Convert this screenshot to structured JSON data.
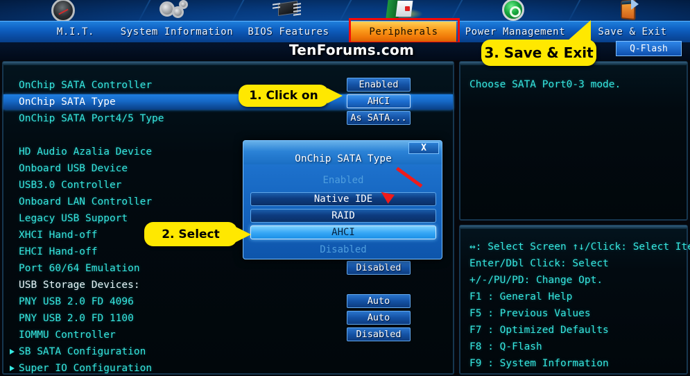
{
  "banner": {
    "icons": [
      {
        "name": "gauge-icon"
      },
      {
        "name": "gears-icon"
      },
      {
        "name": "chip-icon"
      },
      {
        "name": "peripherals-flag-icon"
      },
      {
        "name": "power-icon"
      },
      {
        "name": "exit-door-icon"
      }
    ]
  },
  "tabs": [
    {
      "label": "M.I.T.",
      "active": false
    },
    {
      "label": "System Information",
      "active": false
    },
    {
      "label": "BIOS Features",
      "active": false
    },
    {
      "label": "Peripherals",
      "active": true
    },
    {
      "label": "Power Management",
      "active": false
    },
    {
      "label": "Save & Exit",
      "active": false
    }
  ],
  "watermark": "TenForums.com",
  "qflash_label": "Q-Flash",
  "settings": [
    {
      "label": "OnChip SATA Controller",
      "value": "Enabled",
      "selected": false,
      "submenu": false,
      "white": false
    },
    {
      "label": "OnChip SATA Type",
      "value": "AHCI",
      "selected": true,
      "submenu": false,
      "white": false,
      "value_hot": true
    },
    {
      "label": "OnChip SATA Port4/5 Type",
      "value": "As SATA...",
      "selected": false,
      "submenu": false,
      "white": false
    },
    {
      "label": "HD Audio Azalia Device",
      "value": "",
      "selected": false,
      "submenu": false,
      "white": false
    },
    {
      "label": "Onboard USB Device",
      "value": "",
      "selected": false,
      "submenu": false,
      "white": false
    },
    {
      "label": "USB3.0 Controller",
      "value": "",
      "selected": false,
      "submenu": false,
      "white": false
    },
    {
      "label": "Onboard LAN Controller",
      "value": "",
      "selected": false,
      "submenu": false,
      "white": false
    },
    {
      "label": "Legacy USB Support",
      "value": "",
      "selected": false,
      "submenu": false,
      "white": false
    },
    {
      "label": "XHCI Hand-off",
      "value": "",
      "selected": false,
      "submenu": false,
      "white": false
    },
    {
      "label": "EHCI Hand-off",
      "value": "",
      "selected": false,
      "submenu": false,
      "white": false
    },
    {
      "label": "Port 60/64 Emulation",
      "value": "Disabled",
      "selected": false,
      "submenu": false,
      "white": false
    },
    {
      "label": "USB Storage Devices:",
      "value": "",
      "selected": false,
      "submenu": false,
      "white": true
    },
    {
      "label": "PNY USB 2.0 FD 4096",
      "value": "Auto",
      "selected": false,
      "submenu": false,
      "white": false
    },
    {
      "label": "PNY USB 2.0 FD 1100",
      "value": "Auto",
      "selected": false,
      "submenu": false,
      "white": false
    },
    {
      "label": "IOMMU Controller",
      "value": "Disabled",
      "selected": false,
      "submenu": false,
      "white": false
    },
    {
      "label": "SB SATA Configuration",
      "value": "",
      "selected": false,
      "submenu": true,
      "white": false
    },
    {
      "label": "Super IO Configuration",
      "value": "",
      "selected": false,
      "submenu": true,
      "white": false
    }
  ],
  "help": {
    "text": "Choose SATA Port0-3 mode."
  },
  "keys": [
    "↔: Select Screen  ↑↓/Click: Select Item",
    "Enter/Dbl Click: Select",
    "+/-/PU/PD: Change Opt.",
    "F1  : General Help",
    "F5  : Previous Values",
    "F7  : Optimized Defaults",
    "F8  : Q-Flash",
    "F9  : System Information"
  ],
  "modal": {
    "title": "OnChip SATA Type",
    "close_label": "X",
    "options": [
      {
        "label": "Enabled",
        "state": "ghost"
      },
      {
        "label": "Native IDE",
        "state": "normal"
      },
      {
        "label": "RAID",
        "state": "normal"
      },
      {
        "label": "AHCI",
        "state": "active"
      },
      {
        "label": "Disabled",
        "state": "ghost"
      }
    ]
  },
  "callouts": [
    {
      "id": "co1",
      "text": "1. Click on"
    },
    {
      "id": "co2",
      "text": "2. Select"
    },
    {
      "id": "co3",
      "text": "3. Save & Exit"
    }
  ],
  "colors": {
    "accent_orange": "#f08010",
    "highlight_red": "#f20b0b",
    "callout_yellow": "#ffe800",
    "text_cyan": "#36e7e0",
    "tab_blue": "#0f62c4"
  }
}
